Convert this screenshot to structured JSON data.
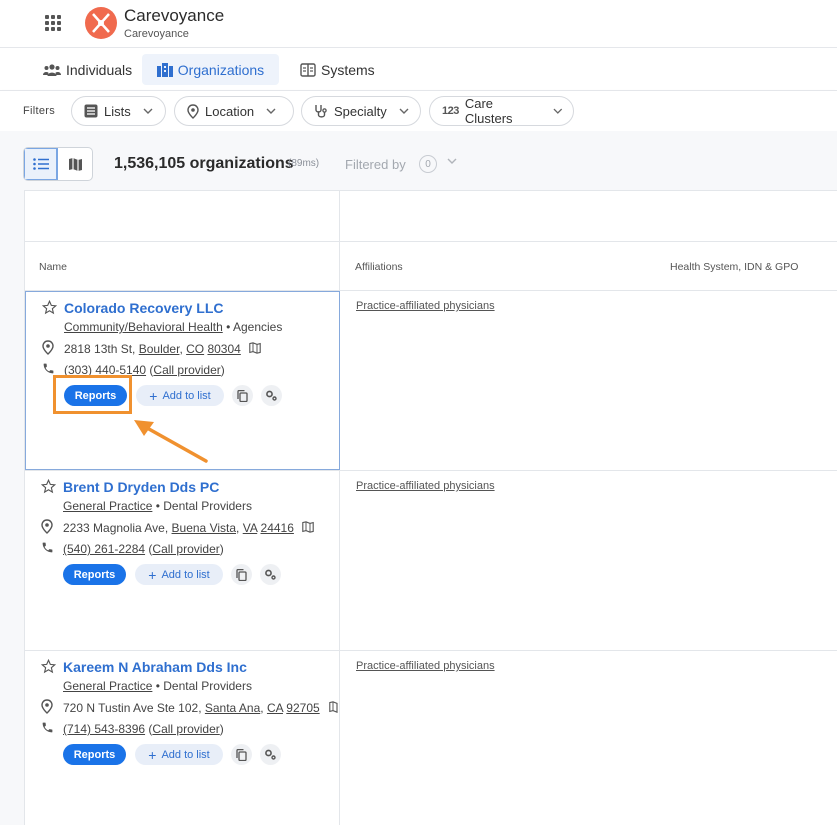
{
  "header": {
    "brand_name": "Carevoyance",
    "brand_sub": "Carevoyance",
    "accent": "#f06a4e"
  },
  "tabs": [
    {
      "label": "Individuals",
      "icon": "people-icon",
      "active": false
    },
    {
      "label": "Organizations",
      "icon": "building-icon",
      "active": true
    },
    {
      "label": "Systems",
      "icon": "systems-icon",
      "active": false
    }
  ],
  "filters": {
    "label": "Filters",
    "chips": [
      {
        "label": "Lists",
        "icon": "list-icon"
      },
      {
        "label": "Location",
        "icon": "location-pin-icon"
      },
      {
        "label": "Specialty",
        "icon": "stethoscope-icon"
      },
      {
        "label": "Care Clusters",
        "icon": "numbers-icon"
      }
    ]
  },
  "toolbar": {
    "count": "1,536,105 organizations",
    "timing": "(89ms)",
    "filtered_by": "Filtered by",
    "filtered_count": "0"
  },
  "columns": {
    "name": "Name",
    "affiliations": "Affiliations",
    "health_system": "Health System, IDN & GPO"
  },
  "rows": [
    {
      "name": "Colorado Recovery LLC",
      "category": "Community/Behavioral Health",
      "category_sep": " • ",
      "subcategory": "Agencies",
      "street": "2818 13th St, ",
      "city": "Boulder",
      "comma": ", ",
      "state": "CO",
      "zip": "80304",
      "phone": "(303) 440-5140",
      "call": "Call provider",
      "affiliation": "Practice-affiliated physicians"
    },
    {
      "name": "Brent D Dryden Dds PC",
      "category": "General Practice",
      "category_sep": " • ",
      "subcategory": "Dental Providers",
      "street": "2233 Magnolia Ave, ",
      "city": "Buena Vista",
      "comma": ", ",
      "state": "VA",
      "zip": "24416",
      "phone": "(540) 261-2284",
      "call": "Call provider",
      "affiliation": "Practice-affiliated physicians"
    },
    {
      "name": "Kareem N Abraham Dds Inc",
      "category": "General Practice",
      "category_sep": " • ",
      "subcategory": "Dental Providers",
      "street": "720 N Tustin Ave Ste 102, ",
      "city": "Santa Ana",
      "comma": ", ",
      "state": "CA",
      "zip": "92705",
      "phone": "(714) 543-8396",
      "call": "Call provider",
      "affiliation": "Practice-affiliated physicians"
    }
  ],
  "buttons": {
    "reports": "Reports",
    "add_to_list": "Add to list"
  },
  "colors": {
    "link_blue": "#2f6fcf",
    "primary": "#1a73e8",
    "highlight": "#f0912f"
  }
}
